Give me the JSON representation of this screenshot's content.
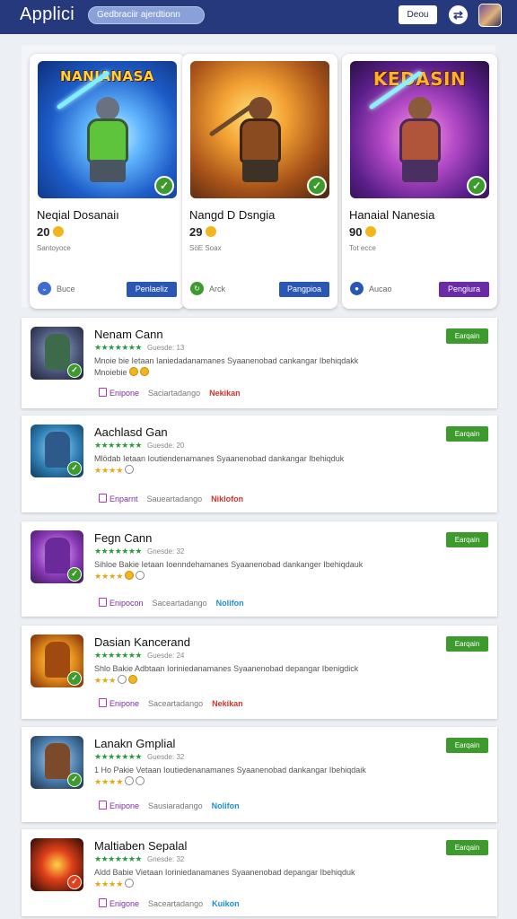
{
  "header": {
    "title": "Applici",
    "search_text": "Gedbraciir ajerdtionn",
    "button_label": "Deou",
    "settings_icon": "sliders-icon",
    "avatar": "user-avatar"
  },
  "featured": [
    {
      "image_title": "NANJANASA",
      "name": "Neqial Dosanaiı",
      "rating": "20",
      "sub": "Santoyoce",
      "dev": "Buce",
      "dev_icon": "chevron-down-icon",
      "dev_color": "#3f6bd1",
      "button": "Penlaeliz",
      "button_color": "#2a56b4"
    },
    {
      "image_title": "",
      "name": "Nangd D Dsngia",
      "rating": "29",
      "sub": "SöE Soax",
      "dev": "Arck",
      "dev_icon": "refresh-icon",
      "dev_color": "#3d9a2d",
      "button": "Pangpioa",
      "button_color": "#2a56b4"
    },
    {
      "image_title": "KEDASIN",
      "name": "Hanaial Nanesia",
      "rating": "90",
      "sub": "Tot ecce",
      "dev": "Aucao",
      "dev_icon": "chat-icon",
      "dev_color": "#2a56b4",
      "button": "Pengiura",
      "button_color": "#6b2aa8"
    }
  ],
  "list": [
    {
      "title": "Nenam Cann",
      "stars": "★★★★★★★",
      "meta": "Guesde: 13",
      "desc": "Mnoie bie Ietaan Ianiedadanamanes Syaanenobad cankangar Ibehiqdakk",
      "desc2": "Mnoiebie",
      "category": "Enipone",
      "developer": "Saciartadango",
      "badge": "Nekikan",
      "badge_color": "#d9332b",
      "button": "Earqain"
    },
    {
      "title": "Aachlasd Gan",
      "stars": "★★★★★★★",
      "meta": "Guesde: 20",
      "desc": "Mlödab Ietaan Ioutiendenamanes Syaanenobad dankangar Ibehiqduk",
      "desc2": "★★★★",
      "category": "Enparnt",
      "developer": "Saueartadango",
      "badge": "Niklofon",
      "badge_color": "#d9332b",
      "button": "Earqain"
    },
    {
      "title": "Fegn Cann",
      "stars": "★★★★★★★",
      "meta": "Gnesde: 32",
      "desc": "Sihloe Bakie Ietaan Ioenndehamanes Syaanenobad dankanger Ibehiqdauk",
      "desc2": "★★★★",
      "category": "Enipocon",
      "developer": "Saceartadango",
      "badge": "Nolifon",
      "badge_color": "#1c8fd0",
      "button": "Earqain"
    },
    {
      "title": "Dasian Kancerand",
      "stars": "★★★★★★★",
      "meta": "Guesde: 24",
      "desc": "Shlo Bakie Adbtaan Ioriniedanamanes Syaanenobad depangar Ibenigdick",
      "desc2": "★★★",
      "category": "Enipone",
      "developer": "Saceartadango",
      "badge": "Nekikan",
      "badge_color": "#d9332b",
      "button": "Earqain"
    },
    {
      "title": "Lanakn Gmplial",
      "stars": "★★★★★★★",
      "meta": "Guesde: 32",
      "desc": "1 Ho Pakie Vetaan Ioutiedenanamanes Syaanenobad dankangar Ibehiqdaik",
      "desc2": "★★★★",
      "category": "Enipone",
      "developer": "Sausiaradango",
      "badge": "Nolifon",
      "badge_color": "#1c8fd0",
      "button": "Earqain"
    },
    {
      "title": "Maltiaben Sepalal",
      "stars": "★★★★★★★",
      "meta": "Gnesde: 32",
      "desc": "Aldd Babie Vietaan Ioriniedanamanes Syaanenobad depangar Ibehiqduk",
      "desc2": "★★★★",
      "category": "Enigone",
      "developer": "Saceartadango",
      "badge": "Kuikon",
      "badge_color": "#1c8fd0",
      "button": "Earqain"
    }
  ]
}
